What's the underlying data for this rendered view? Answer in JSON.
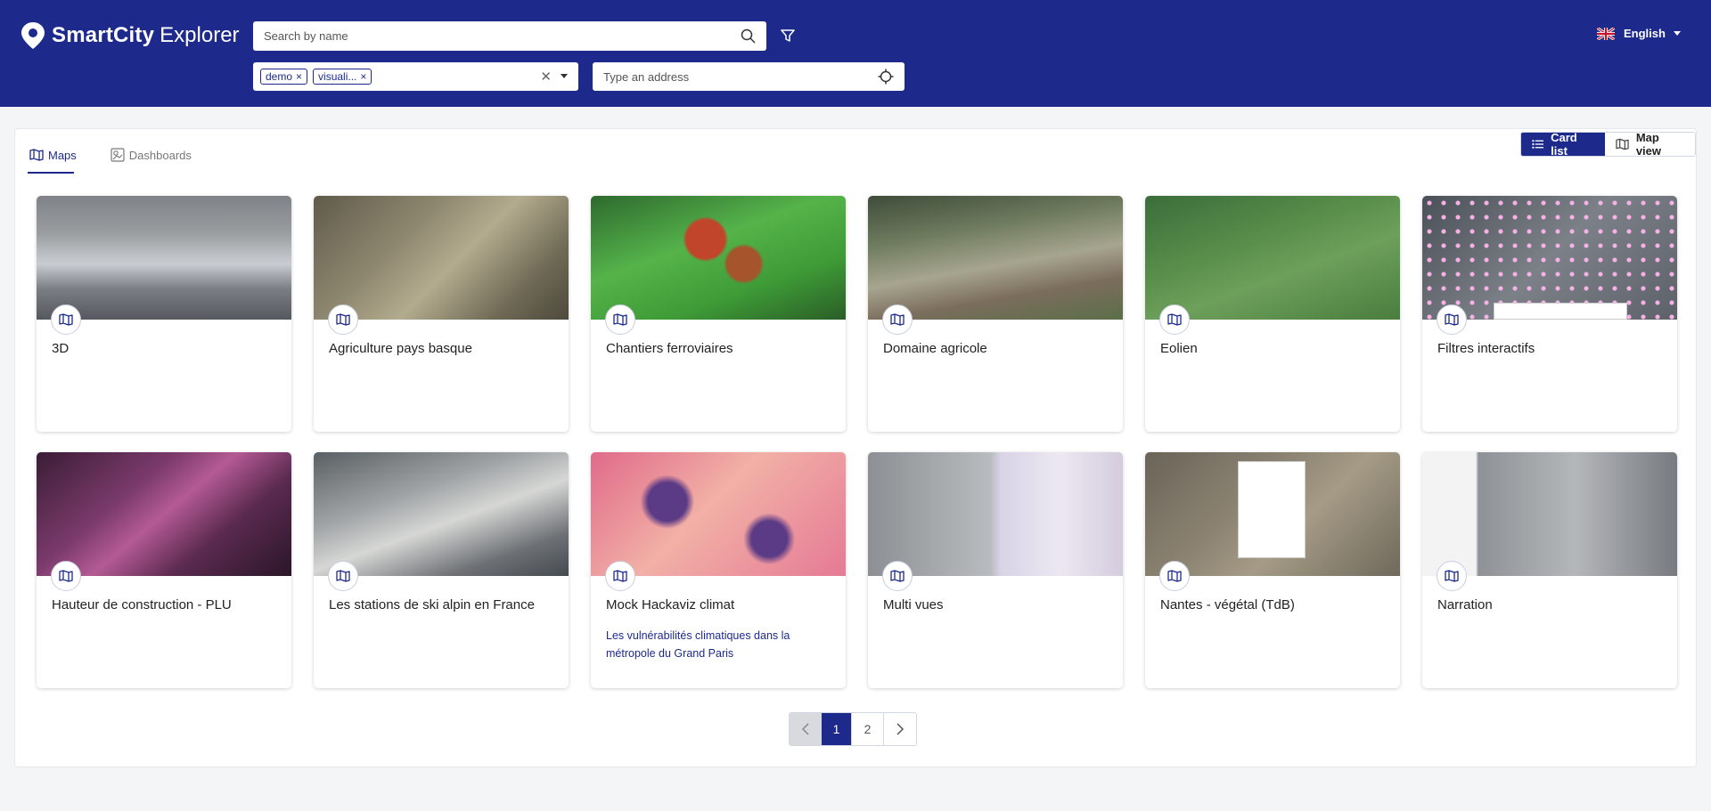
{
  "header": {
    "brand_bold": "SmartCity",
    "brand_light": "Explorer",
    "search_placeholder": "Search by name",
    "tags": [
      "demo",
      "visuali..."
    ],
    "address_placeholder": "Type an address",
    "language": "English"
  },
  "tabs": [
    {
      "label": "Maps",
      "active": true
    },
    {
      "label": "Dashboards",
      "active": false
    }
  ],
  "view_toggle": {
    "card_list": "Card list",
    "map_view": "Map view"
  },
  "cards": [
    {
      "title": "3D",
      "description": ""
    },
    {
      "title": "Agriculture pays basque",
      "description": ""
    },
    {
      "title": "Chantiers ferroviaires",
      "description": ""
    },
    {
      "title": "Domaine agricole",
      "description": ""
    },
    {
      "title": "Eolien",
      "description": ""
    },
    {
      "title": "Filtres interactifs",
      "description": ""
    },
    {
      "title": "Hauteur de construction - PLU",
      "description": ""
    },
    {
      "title": "Les stations de ski alpin en France",
      "description": ""
    },
    {
      "title": "Mock Hackaviz climat",
      "description": "Les vulnérabilités climatiques dans la métropole du Grand Paris"
    },
    {
      "title": "Multi vues",
      "description": ""
    },
    {
      "title": "Nantes - végétal (TdB)",
      "description": ""
    },
    {
      "title": "Narration",
      "description": ""
    }
  ],
  "pagination": {
    "pages": [
      "1",
      "2"
    ],
    "current": "1"
  },
  "colors": {
    "brand": "#1d2a8c",
    "background": "#f4f5f7"
  }
}
